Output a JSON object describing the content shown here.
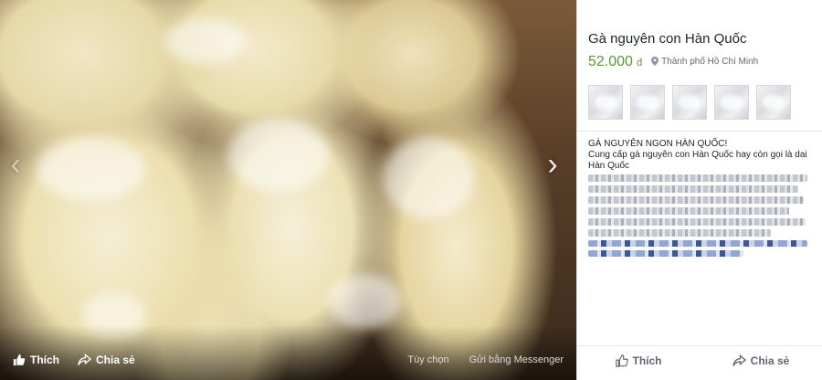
{
  "viewer": {
    "like_label": "Thích",
    "share_label": "Chia sẻ",
    "options_label": "Tùy chọn",
    "send_label": "Gửi bằng Messenger",
    "prev_arrow": "‹",
    "next_arrow": "›"
  },
  "listing": {
    "title": "Gà nguyên con Hàn Quốc",
    "price": "52.000",
    "currency": "đ",
    "location": "Thành phố Hồ Chí Minh",
    "thumbnail_count": 5,
    "description_heading": "GÀ NGUYÊN NGON HÀN QUỐC!",
    "description_line": "Cung cấp gà nguyên con Hàn Quốc hay còn gọi là dai Hàn Quốc"
  },
  "panel_actions": {
    "like_label": "Thích",
    "share_label": "Chia sẻ"
  },
  "colors": {
    "price": "#5b9a2e",
    "link_blue": "#3b5998"
  }
}
